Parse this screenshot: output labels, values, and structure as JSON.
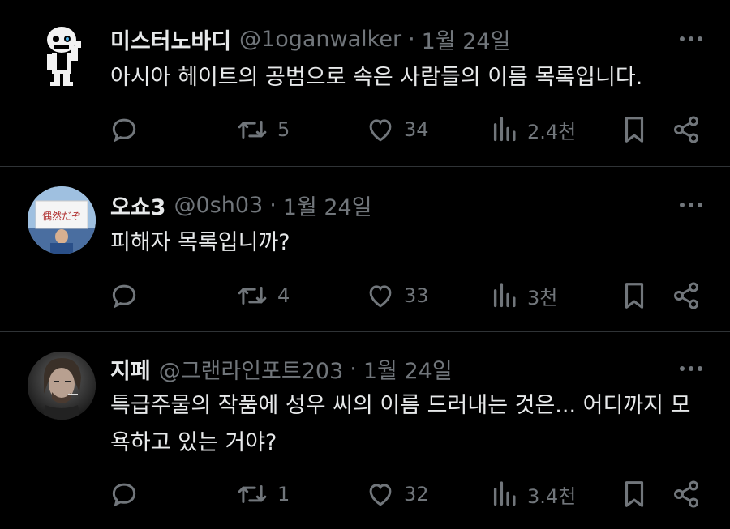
{
  "colors": {
    "background": "#000000",
    "text": "#e7e9ea",
    "muted": "#71767b",
    "divider": "#2f3336"
  },
  "tweets": [
    {
      "display_name": "미스터노바디",
      "handle": "@1oganwalker",
      "date": "1월 24일",
      "text": "아시아 헤이트의 공범으로 속은 사람들의 이름 목록입니다.",
      "replies_icon": "reply-icon",
      "retweets": "5",
      "likes": "34",
      "views": "2.4천"
    },
    {
      "display_name": "오쇼3",
      "handle": "@0sh03",
      "date": "1월 24일",
      "text": "피해자 목록입니까?",
      "retweets": "4",
      "likes": "33",
      "views": "3천"
    },
    {
      "display_name": "지페",
      "handle": "@그랜라인포트203",
      "date": "1월 24일",
      "text": "특급주물의 작품에 성우 씨의 이름 드러내는 것은... 어디까지 모욕하고 있는 거야?",
      "retweets": "1",
      "likes": "32",
      "views": "3.4천"
    }
  ],
  "avatar2_sign_text": "偶然だぞ"
}
